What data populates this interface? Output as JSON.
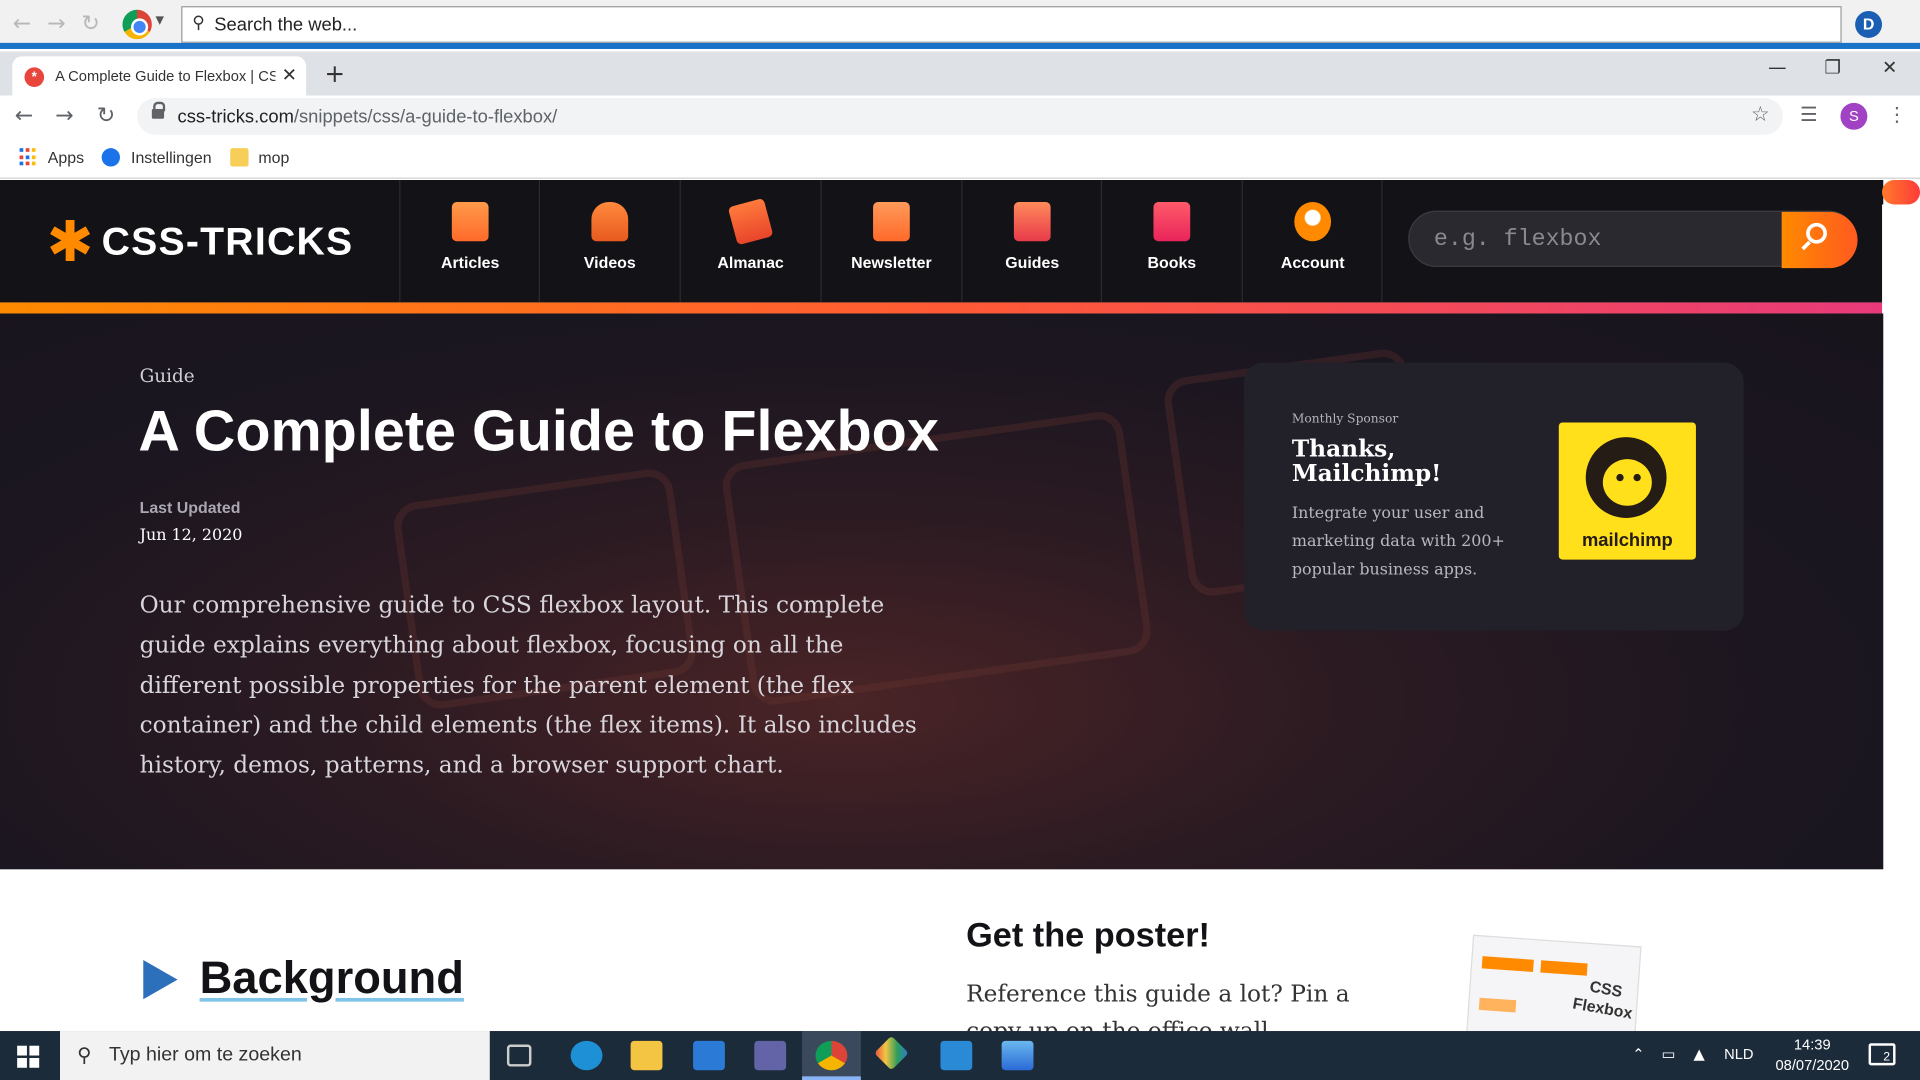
{
  "topbar": {
    "search_text": "Search the web..."
  },
  "tab": {
    "title": "A Complete Guide to Flexbox | CSS-Tricks"
  },
  "address": {
    "domain": "css-tricks.com",
    "path": "/snippets/css/a-guide-to-flexbox/"
  },
  "profile_initial": "S",
  "bookmarks": [
    {
      "label": "Apps"
    },
    {
      "label": "Instellingen"
    },
    {
      "label": "mop"
    }
  ],
  "site": {
    "logo_text": "CSS-TRICKS",
    "nav": [
      {
        "label": "Articles",
        "icon": "articles-icon",
        "color": "#ff8a3c"
      },
      {
        "label": "Videos",
        "icon": "videos-icon",
        "color": "#ff7a1f"
      },
      {
        "label": "Almanac",
        "icon": "almanac-icon",
        "color": "#ff5a3c"
      },
      {
        "label": "Newsletter",
        "icon": "newsletter-icon",
        "color": "#ff8a3c"
      },
      {
        "label": "Guides",
        "icon": "guides-icon",
        "color": "#ff6b4a"
      },
      {
        "label": "Books",
        "icon": "books-icon",
        "color": "#ff3b6b"
      },
      {
        "label": "Account",
        "icon": "account-icon",
        "color": "#ff8a00"
      }
    ],
    "search_placeholder": "e.g. flexbox"
  },
  "hero": {
    "kicker": "Guide",
    "title": "A Complete Guide to Flexbox",
    "last_updated_label": "Last Updated",
    "last_updated_date": "Jun 12, 2020",
    "intro": "Our comprehensive guide to CSS flexbox layout. This complete guide explains everything about flexbox, focusing on all the different possible properties for the parent element (the flex container) and the child elements (the flex items). It also includes history, demos, patterns, and a browser support chart."
  },
  "sponsor": {
    "label": "Monthly Sponsor",
    "title": "Thanks, Mailchimp!",
    "description": "Integrate your user and marketing data with 200+ popular business apps.",
    "logo_word": "mailchimp"
  },
  "content": {
    "section_title": "Background",
    "poster_title": "Get the poster!",
    "poster_text": "Reference this guide a lot? Pin a copy up on the office wall."
  },
  "taskbar": {
    "search_text": "Typ hier om te zoeken",
    "language": "NLD",
    "time": "14:39",
    "date": "08/07/2020",
    "notifications": "2"
  }
}
